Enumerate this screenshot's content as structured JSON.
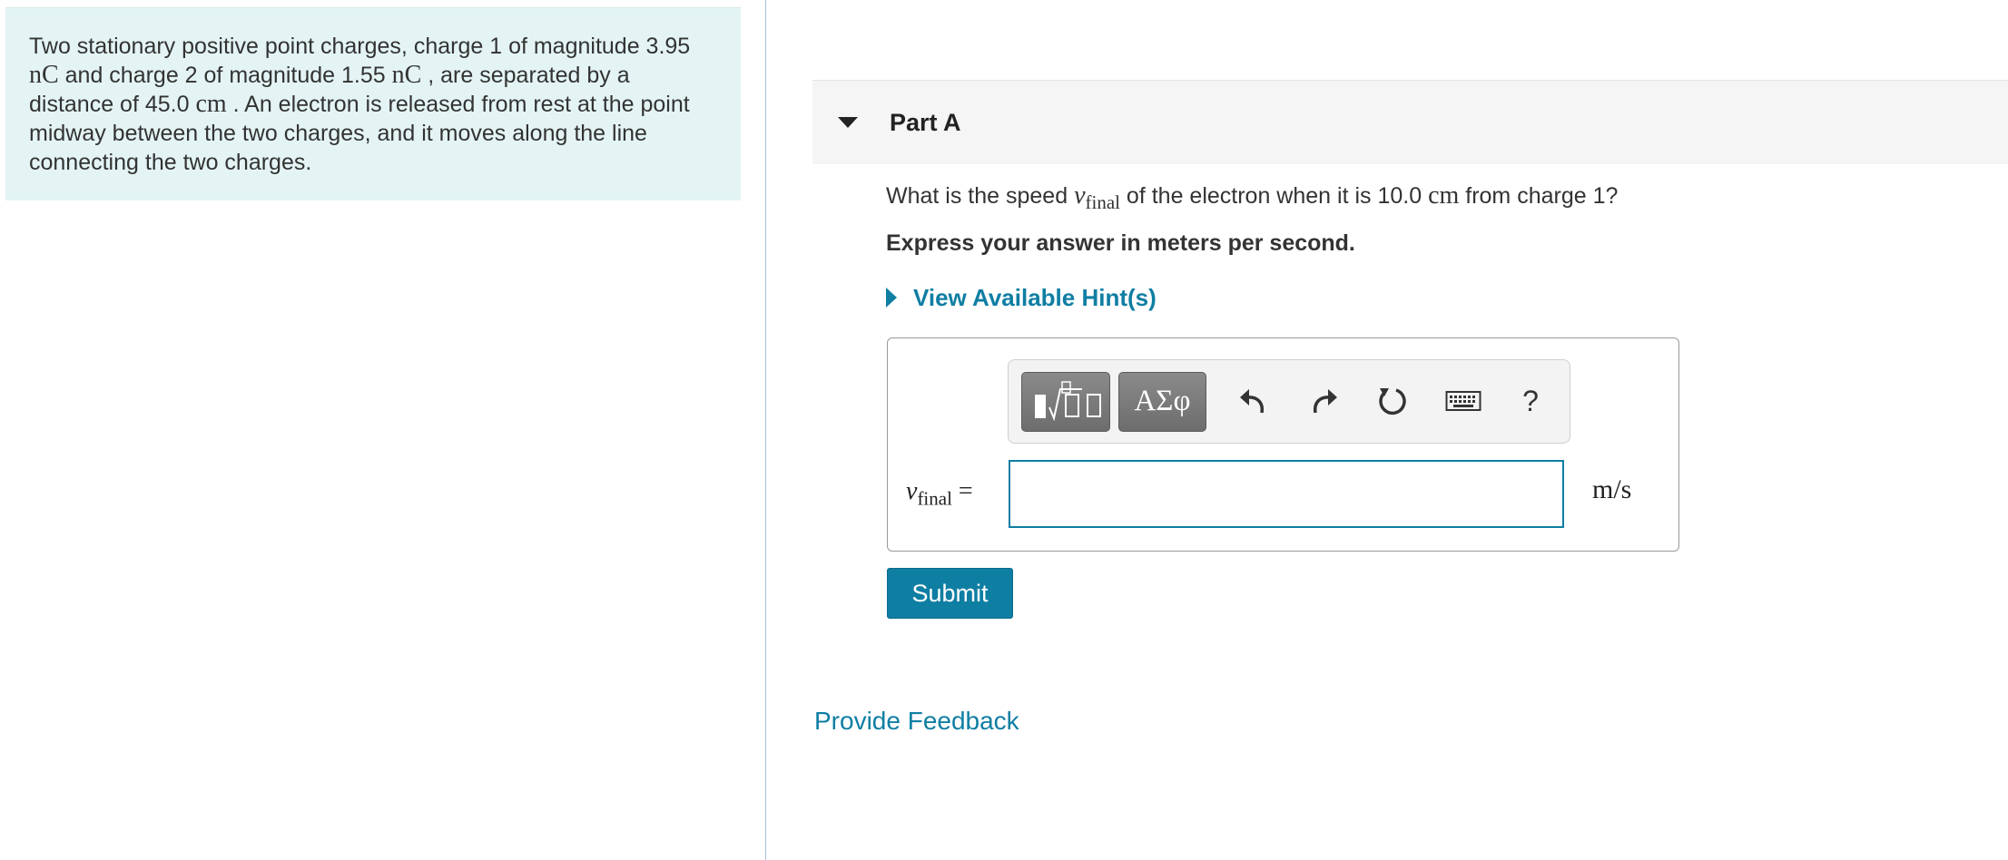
{
  "problem": {
    "seg1": "Two stationary positive point charges, charge 1 of magnitude 3.95",
    "unit_nc_1": "nC",
    "seg2": " and charge 2 of magnitude 1.55 ",
    "unit_nc_2": "nC",
    "seg3": " , are separated by a distance of 45.0 ",
    "unit_cm": "cm",
    "seg4": " . An electron is released from rest at the point midway between the two charges, and it moves along the line connecting the two charges."
  },
  "part": {
    "title": "Part A",
    "question_pre": "What is the speed ",
    "var_symbol": "v",
    "var_sub": "final",
    "question_mid": " of the electron when it is 10.0 ",
    "question_unit": "cm",
    "question_post": " from charge 1?",
    "instruction": "Express your answer in meters per second.",
    "hint_label": "View Available Hint(s)"
  },
  "answer": {
    "lhs_symbol": "v",
    "lhs_sub": "final",
    "lhs_equals": " =",
    "value": "",
    "units": "m/s",
    "toolbar": {
      "template_icon": "template-sqrt-icon",
      "greek_label": "ΑΣφ",
      "undo_icon": "undo-icon",
      "redo_icon": "redo-icon",
      "reset_icon": "reset-icon",
      "keyboard_icon": "keyboard-icon",
      "help_label": "?"
    }
  },
  "submit_label": "Submit",
  "feedback_label": "Provide Feedback",
  "colors": {
    "accent": "#0f7ea3",
    "problem_bg": "#e4f4f4",
    "header_bg": "#f5f5f5"
  }
}
